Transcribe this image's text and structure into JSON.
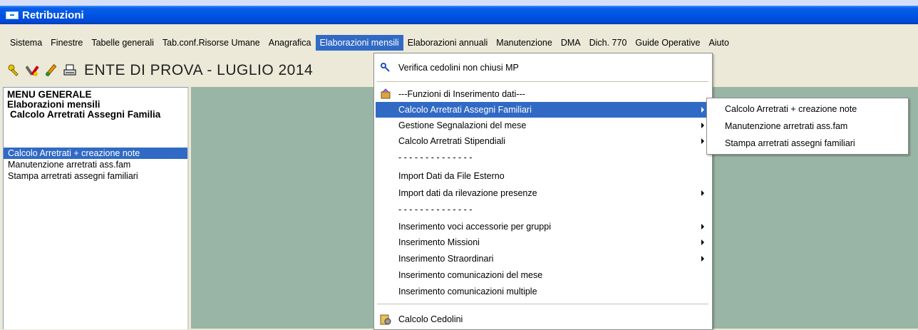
{
  "window": {
    "title": "Retribuzioni"
  },
  "menubar": {
    "items": [
      "Sistema",
      "Finestre",
      "Tabelle generali",
      "Tab.conf.Risorse Umane",
      "Anagrafica",
      "Elaborazioni mensili",
      "Elaborazioni annuali",
      "Manutenzione",
      "DMA",
      "Dich. 770",
      "Guide Operative",
      "Aiuto"
    ],
    "active": "Elaborazioni mensili"
  },
  "toolbar": {
    "ente": "ENTE DI PROVA - LUGLIO 2014",
    "icons": [
      "key-icon",
      "tools-icon",
      "edit-pencil-icon",
      "printer-icon"
    ]
  },
  "leftpanel": {
    "heading1": "MENU GENERALE",
    "heading2": "Elaborazioni mensili",
    "heading3": "Calcolo Arretrati Assegni Familia",
    "items": [
      "Calcolo Arretrati + creazione note",
      "Manutenzione arretrati ass.fam",
      "Stampa arretrati assegni familiari"
    ],
    "selected_index": 0
  },
  "dropdown": {
    "items": [
      {
        "label": "Verifica cedolini non chiusi MP",
        "icon": "magnifier-check-icon"
      },
      {
        "label": "---Funzioni di Inserimento dati---",
        "icon": "data-entry-icon"
      },
      {
        "label": "Calcolo Arretrati Assegni Familiari",
        "submenu": true,
        "highlighted": true
      },
      {
        "label": "Gestione Segnalazioni del mese",
        "submenu": true
      },
      {
        "label": "Calcolo Arretrati Stipendiali",
        "submenu": true
      },
      {
        "label": "- - - - - - - - - - - - - -"
      },
      {
        "label": "Import Dati da File Esterno"
      },
      {
        "label": "Import dati da rilevazione presenze",
        "submenu": true
      },
      {
        "label": "- - - - - - - - - - - - - -"
      },
      {
        "label": "Inserimento voci accessorie per gruppi",
        "submenu": true
      },
      {
        "label": "Inserimento Missioni",
        "submenu": true
      },
      {
        "label": "Inserimento Straordinari",
        "submenu": true
      },
      {
        "label": "Inserimento comunicazioni del mese"
      },
      {
        "label": "Inserimento comunicazioni multiple"
      },
      {
        "label": "Calcolo Cedolini",
        "icon": "calculator-gear-icon"
      }
    ]
  },
  "submenu": {
    "items": [
      "Calcolo Arretrati + creazione note",
      "Manutenzione arretrati ass.fam",
      "Stampa arretrati assegni familiari"
    ]
  },
  "colors": {
    "title_blue": "#0054e3",
    "highlight": "#316ac5",
    "workspace": "#99b5a5",
    "chrome": "#ece9d8"
  }
}
